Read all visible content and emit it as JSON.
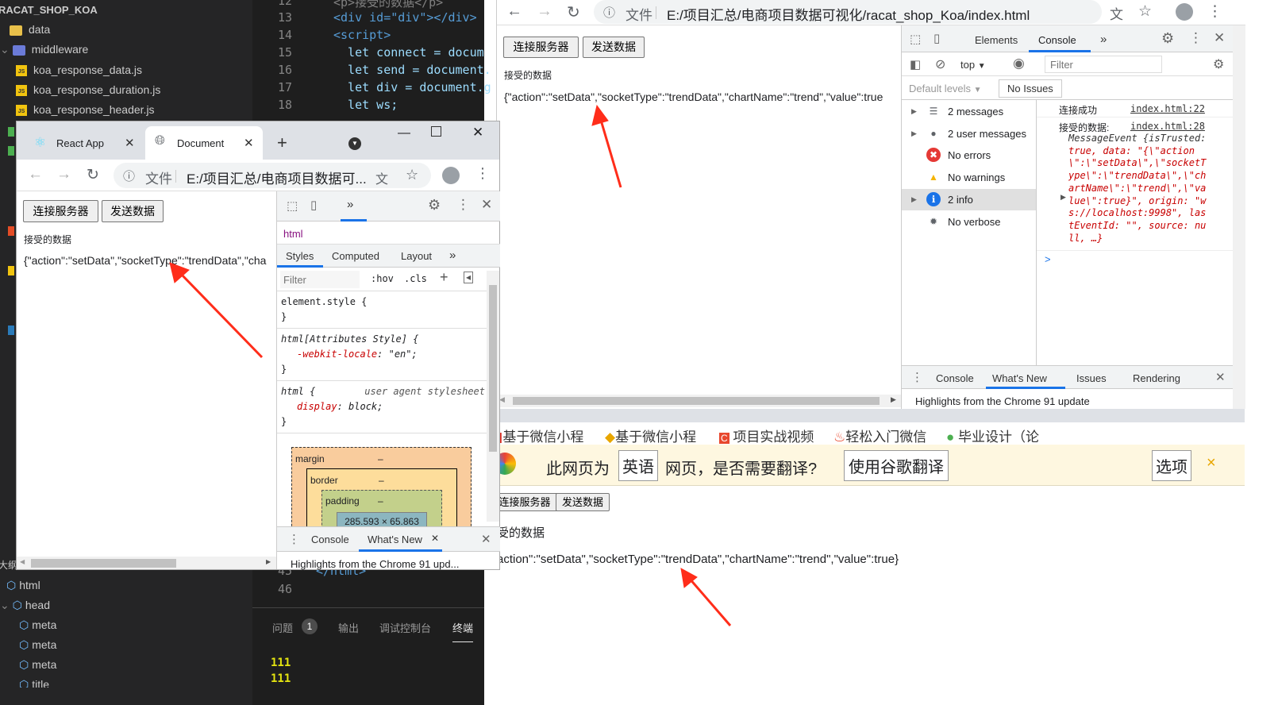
{
  "vscode": {
    "explorer": {
      "title": "RACAT_SHOP_KOA",
      "items": [
        {
          "label": "data",
          "type": "folder"
        },
        {
          "label": "middleware",
          "type": "folder"
        },
        {
          "label": "koa_response_data.js",
          "type": "js"
        },
        {
          "label": "koa_response_duration.js",
          "type": "js"
        },
        {
          "label": "koa_response_header.js",
          "type": "js"
        }
      ]
    },
    "outline": {
      "title": "大纲",
      "items": [
        "html",
        "head",
        "meta",
        "meta",
        "meta",
        "title"
      ]
    },
    "code_top": [
      {
        "n": "12",
        "t": "<p>接受的数据</p>"
      },
      {
        "n": "13",
        "t": "<div id=\"div\"></div>"
      },
      {
        "n": "14",
        "t": "<script>"
      },
      {
        "n": "15",
        "t": "  let connect = docum"
      },
      {
        "n": "16",
        "t": "  let send = document."
      },
      {
        "n": "17",
        "t": "  let div = document.g"
      },
      {
        "n": "18",
        "t": "  let ws;"
      }
    ],
    "code_bottom": [
      {
        "n": "45",
        "t": "</html>"
      },
      {
        "n": "46",
        "t": ""
      }
    ],
    "panel": {
      "tabs": [
        "问题",
        "输出",
        "调试控制台",
        "终端"
      ],
      "problems_count": "1",
      "terminal_lines": [
        "111",
        "111"
      ]
    }
  },
  "small_browser": {
    "tabs": [
      {
        "label": "React App",
        "icon": "react-icon"
      },
      {
        "label": "Document",
        "icon": "globe-icon"
      }
    ],
    "file_label": "文件",
    "url": "E:/项目汇总/电商项目数据可...",
    "page": {
      "connect_button": "连接服务器",
      "send_button": "发送数据",
      "label": "接受的数据",
      "json": "{\"action\":\"setData\",\"socketType\":\"trendData\",\"cha"
    },
    "devtools": {
      "more": "»",
      "breadcrumb": "html",
      "subtabs": [
        "Styles",
        "Computed",
        "Layout",
        "»"
      ],
      "filter_placeholder": "Filter",
      "hov": ":hov",
      "cls": ".cls",
      "rules": [
        {
          "selector": "element.style {",
          "props": [],
          "close": "}"
        },
        {
          "selector": "html[Attributes Style] {",
          "props": [
            {
              "k": "-webkit-locale",
              "v": "\"en\";"
            }
          ],
          "close": "}"
        },
        {
          "selector": "html {",
          "source": "user agent stylesheet",
          "props": [
            {
              "k": "display",
              "v": "block;"
            }
          ],
          "close": "}"
        }
      ],
      "box_model": {
        "margin": "margin",
        "border": "border",
        "padding": "padding",
        "dash": "–",
        "content": "285.593 × 65.863"
      },
      "drawer": {
        "tabs": [
          "Console",
          "What's New"
        ],
        "highlight": "Highlights from the Chrome 91 upd..."
      }
    }
  },
  "main_browser": {
    "file_label": "文件",
    "url": "E:/项目汇总/电商项目数据可视化/racat_shop_Koa/index.html",
    "page": {
      "connect_button": "连接服务器",
      "send_button": "发送数据",
      "label": "接受的数据",
      "json": "{\"action\":\"setData\",\"socketType\":\"trendData\",\"chartName\":\"trend\",\"value\":true"
    },
    "devtools": {
      "tabs": [
        "Elements",
        "Console",
        "»"
      ],
      "active_tab": "Console",
      "context": "top",
      "filter_placeholder": "Filter",
      "levels": "Default levels",
      "issues": "No Issues",
      "sidebar": [
        {
          "label": "2 messages",
          "icon": "list-icon",
          "color": "#5f6368"
        },
        {
          "label": "2 user messages",
          "icon": "user-icon",
          "color": "#5f6368"
        },
        {
          "label": "No errors",
          "icon": "error-icon",
          "color": "#e53935"
        },
        {
          "label": "No warnings",
          "icon": "warning-icon",
          "color": "#f4b400"
        },
        {
          "label": "2 info",
          "icon": "info-icon",
          "color": "#1a73e8"
        },
        {
          "label": "No verbose",
          "icon": "bug-icon",
          "color": "#5f6368"
        }
      ],
      "messages": [
        {
          "text": "连接成功",
          "source": "index.html:22"
        },
        {
          "text": "接受的数据:",
          "source": "index.html:28",
          "detail": [
            "MessageEvent {isTrusted:",
            "true, data: \"{\\\"action",
            "\\\":\\\"setData\\\",\\\"socketT",
            "ype\\\":\\\"trendData\\\",\\\"ch",
            "artName\\\":\\\"trend\\\",\\\"va",
            "lue\\\":true}\", origin: \"w",
            "s://localhost:9998\", las",
            "tEventId: \"\", source: nu",
            "ll, …}"
          ]
        }
      ],
      "prompt": ">",
      "drawer": {
        "tabs": [
          "Console",
          "What's New",
          "Issues",
          "Rendering"
        ],
        "active": "What's New",
        "highlight": "Highlights from the Chrome 91 update"
      }
    }
  },
  "back_browser": {
    "bookmarks": [
      "基于微信小程",
      "基于微信小程",
      "项目实战视频",
      "轻松入门微信",
      "毕业设计（论"
    ],
    "translate": {
      "prefix": "此网页为",
      "language": "英语",
      "suffix": "网页，是否需要翻译?",
      "translate_button": "使用谷歌翻译",
      "options_button": "选项",
      "close": "×"
    },
    "page": {
      "connect_button": "连接服务器",
      "send_button": "发送数据",
      "label": "受的数据",
      "json": "action\":\"setData\",\"socketType\":\"trendData\",\"chartName\":\"trend\",\"value\":true}"
    }
  },
  "colors": {
    "arrow": "#ff2d1a",
    "accent": "#1a73e8",
    "translate_bar": "#fef7e0"
  }
}
